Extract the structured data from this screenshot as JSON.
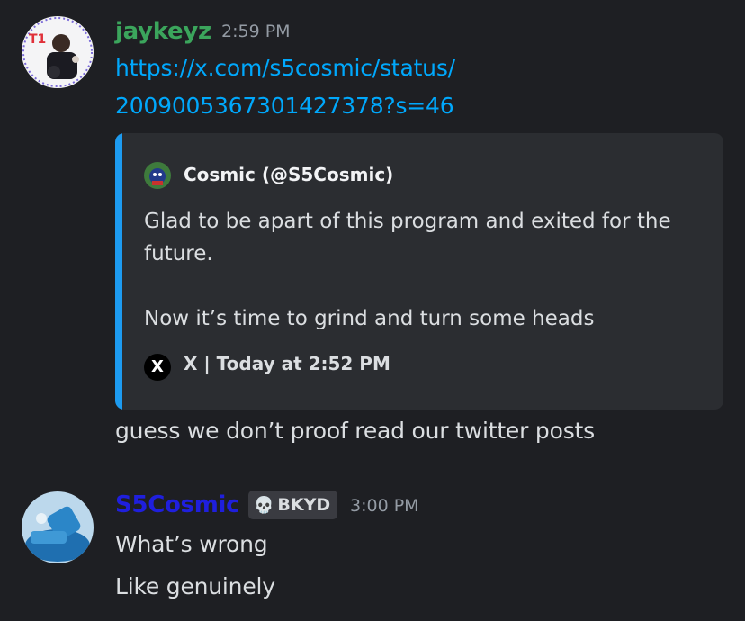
{
  "messages": [
    {
      "username": "jaykeyz",
      "username_color": "#3ba55c",
      "timestamp": "2:59 PM",
      "link_line1": "https://x.com/s5cosmic/status/",
      "link_line2": "2009005367301427378?s=46",
      "embed": {
        "author": "Cosmic (@S5Cosmic)",
        "description": "Glad to be apart of this program and exited for the future.\n\nNow it’s time to grind and turn some heads",
        "footer": "X | Today at 2:52 PM",
        "footer_icon": "X",
        "accent": "#1d9bf0"
      },
      "text": "guess we don’t proof read our twitter posts"
    },
    {
      "username": "S5Cosmic",
      "username_color": "#1f1fdd",
      "badge": {
        "icon": "skull-icon",
        "label": "BKYD"
      },
      "timestamp": "3:00 PM",
      "lines": [
        "What’s wrong",
        "Like genuinely"
      ]
    }
  ]
}
